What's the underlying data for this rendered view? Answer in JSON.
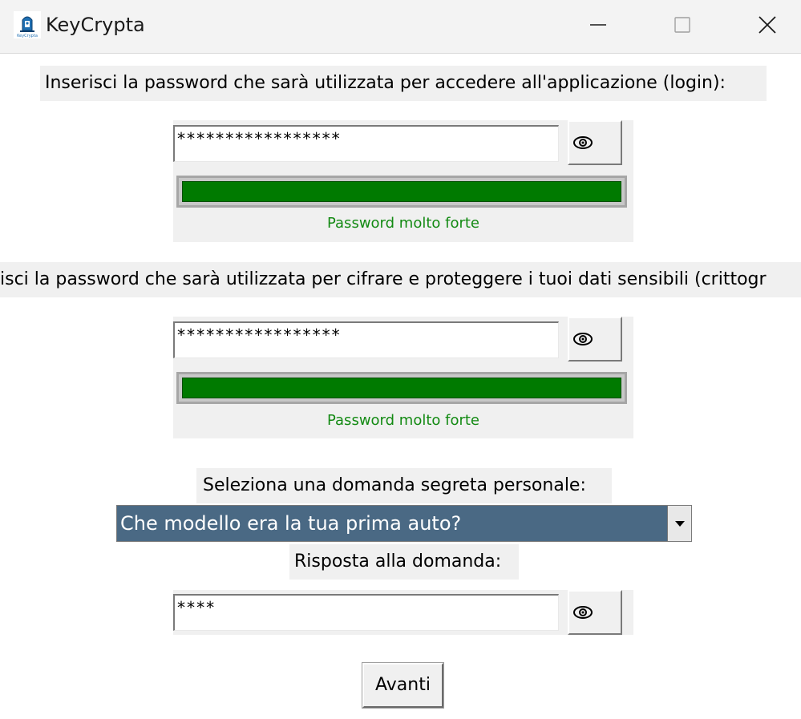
{
  "window": {
    "title": "KeyCrypta",
    "icon": "app-logo-icon",
    "controls": [
      "minimize-icon",
      "maximize-icon",
      "close-icon"
    ]
  },
  "login_section": {
    "label": "Inserisci la password che sarà utilizzata per accedere all'applicazione (login):",
    "password_value": "*****************",
    "toggle_icon": "eye-icon",
    "strength_text": "Password molto forte",
    "strength_level": 1.0,
    "strength_color": "#007a00"
  },
  "crypto_section": {
    "label": "isci la password che sarà utilizzata per cifrare e proteggere i tuoi dati sensibili (crittogr",
    "password_value": "*****************",
    "toggle_icon": "eye-icon",
    "strength_text": "Password molto forte",
    "strength_level": 1.0,
    "strength_color": "#007a00"
  },
  "secret_question": {
    "label": "Seleziona una domanda segreta personale:",
    "selected": "Che modello era la tua prima auto?",
    "highlight_color": "#4a6984"
  },
  "answer": {
    "label": "Risposta alla domanda:",
    "value": "****",
    "toggle_icon": "eye-icon"
  },
  "next_button": {
    "label": "Avanti"
  }
}
